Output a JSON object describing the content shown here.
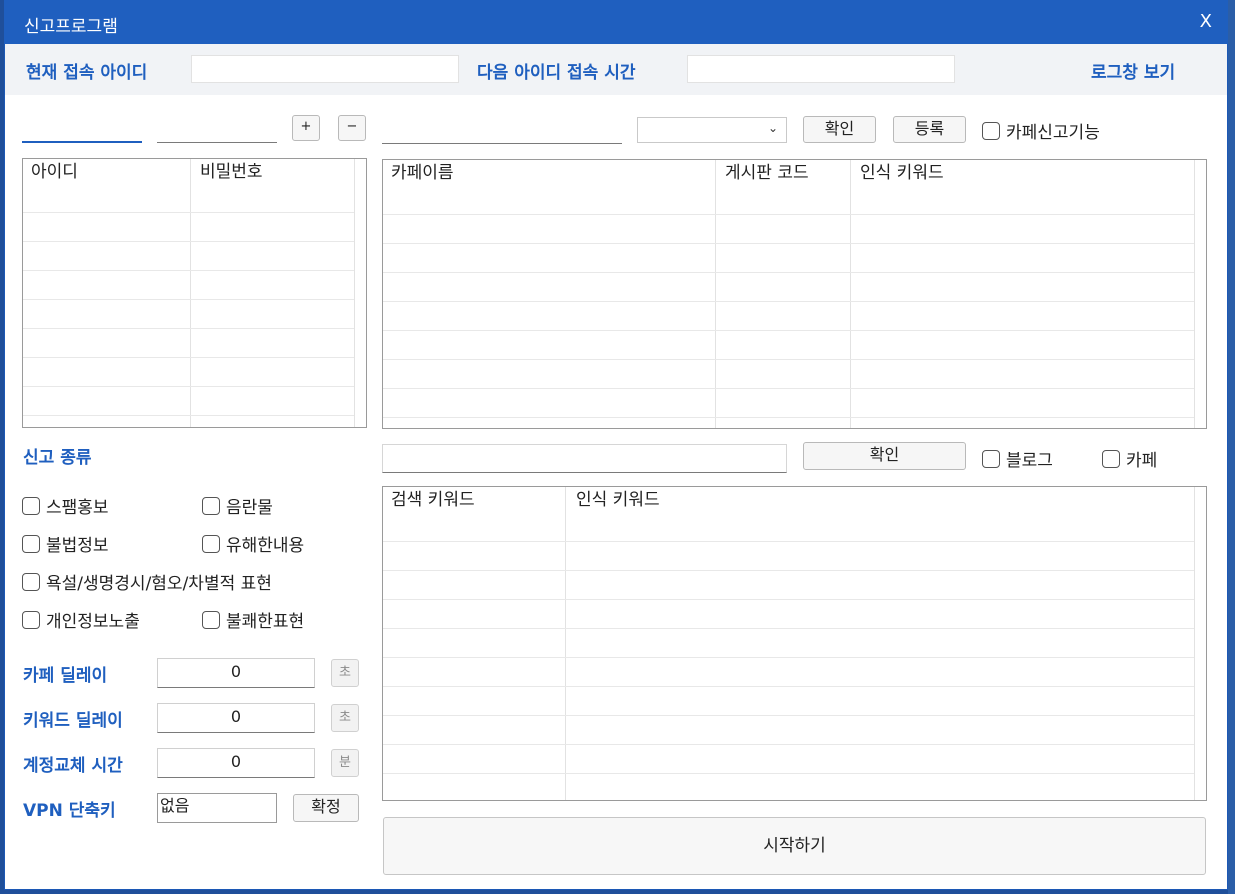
{
  "window": {
    "title": "신고프로그램",
    "close_glyph": "X"
  },
  "top": {
    "current_id_label": "현재 접속 아이디",
    "current_id_value": "",
    "next_id_time_label": "다음 아이디 접속 시간",
    "next_id_time_value": "",
    "view_log_link": "로그창 보기"
  },
  "account_row": {
    "id_input": "",
    "pw_input": "",
    "plus_label": "+",
    "minus_label": "−"
  },
  "cafe_row": {
    "cafe_input": "",
    "select_value": "",
    "confirm_label": "확인",
    "register_label": "등록",
    "cafe_report_checkbox": "카페신고기능"
  },
  "account_table": {
    "columns": [
      "아이디",
      "비밀번호"
    ]
  },
  "cafe_table": {
    "columns": [
      "카페이름",
      "게시판 코드",
      "인식 키워드"
    ]
  },
  "keyword_row": {
    "keyword_input": "",
    "confirm_label": "확인",
    "blog_checkbox": "블로그",
    "cafe_checkbox": "카페"
  },
  "keyword_table": {
    "columns": [
      "검색 키워드",
      "인식 키워드"
    ]
  },
  "report_types": {
    "heading": "신고 종류",
    "items": [
      "스팸홍보",
      "음란물",
      "불법정보",
      "유해한내용",
      "욕설/생명경시/혐오/차별적 표현",
      "개인정보노출",
      "불쾌한표현"
    ]
  },
  "settings": {
    "cafe_delay_label": "카페 딜레이",
    "cafe_delay_value": "0",
    "cafe_delay_unit": "초",
    "keyword_delay_label": "키워드 딜레이",
    "keyword_delay_value": "0",
    "keyword_delay_unit": "초",
    "account_switch_label": "계정교체 시간",
    "account_switch_value": "0",
    "account_switch_unit": "분",
    "vpn_label": "VPN 단축키",
    "vpn_value": "없음",
    "vpn_confirm_label": "확정"
  },
  "start_button": "시작하기",
  "colors": {
    "accent": "#1f5fbf",
    "titlebar": "#1f5fbf"
  }
}
